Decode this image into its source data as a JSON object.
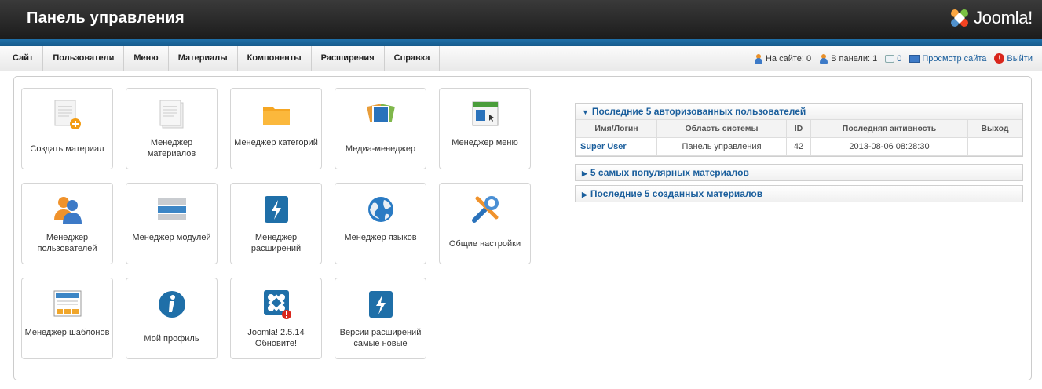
{
  "header": {
    "title": "Панель управления",
    "logo_text": "Joomla!"
  },
  "menu": [
    "Сайт",
    "Пользователи",
    "Меню",
    "Материалы",
    "Компоненты",
    "Расширения",
    "Справка"
  ],
  "status": {
    "on_site": "На сайте: 0",
    "in_panel": "В панели: 1",
    "messages": "0",
    "view_site": "Просмотр сайта",
    "logout": "Выйти"
  },
  "tiles": [
    {
      "label": "Создать материал",
      "icon": "new-article-icon"
    },
    {
      "label": "Менеджер материалов",
      "icon": "article-manager-icon"
    },
    {
      "label": "Менеджер категорий",
      "icon": "folder-icon"
    },
    {
      "label": "Медиа-менеджер",
      "icon": "media-icon"
    },
    {
      "label": "Менеджер меню",
      "icon": "menu-manager-icon"
    },
    {
      "label": "Менеджер пользователей",
      "icon": "users-icon"
    },
    {
      "label": "Менеджер модулей",
      "icon": "modules-icon"
    },
    {
      "label": "Менеджер расширений",
      "icon": "extensions-icon"
    },
    {
      "label": "Менеджер языков",
      "icon": "globe-icon"
    },
    {
      "label": "Общие настройки",
      "icon": "tools-icon"
    },
    {
      "label": "Менеджер шаблонов",
      "icon": "template-icon"
    },
    {
      "label": "Мой профиль",
      "icon": "info-icon"
    },
    {
      "label": "Joomla! 2.5.14 Обновите!",
      "icon": "joomla-update-icon"
    },
    {
      "label": "Версии расширений самые новые",
      "icon": "extension-update-icon"
    }
  ],
  "panels": {
    "users": {
      "title": "Последние 5 авторизованных пользователей",
      "columns": [
        "Имя/Логин",
        "Область системы",
        "ID",
        "Последняя активность",
        "Выход"
      ],
      "rows": [
        {
          "name": "Super User",
          "area": "Панель управления",
          "id": "42",
          "last": "2013-08-06 08:28:30",
          "logout": ""
        }
      ]
    },
    "popular": {
      "title": "5 самых популярных материалов"
    },
    "latest": {
      "title": "Последние 5 созданных материалов"
    }
  },
  "colors": {
    "header_bg": "#1c1c1c",
    "accent_blue": "#1a5e9c",
    "band": "#1f6fa8"
  }
}
